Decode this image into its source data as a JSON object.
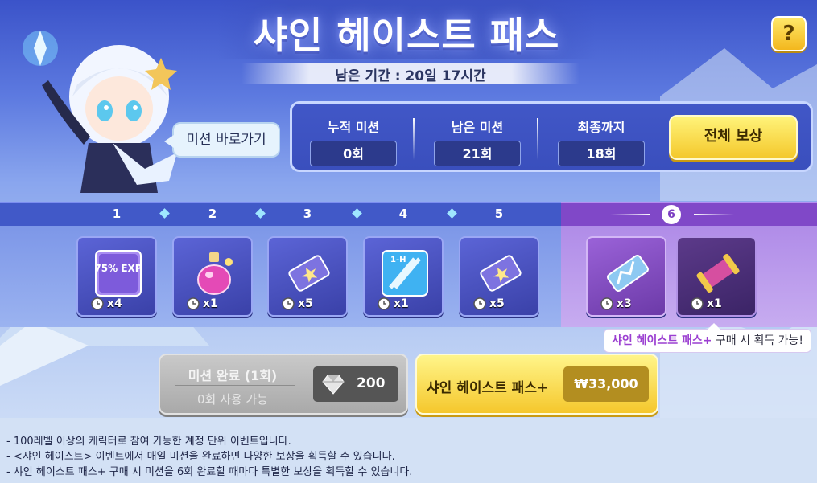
{
  "header": {
    "title": "샤인 헤이스트 패스",
    "period": "남은 기간 : 20일 17시간",
    "help_label": "?"
  },
  "mission_shortcut": "미션 바로가기",
  "stats": [
    {
      "label": "누적 미션",
      "value": "0회"
    },
    {
      "label": "남은 미션",
      "value": "21회"
    },
    {
      "label": "최종까지",
      "value": "18회"
    }
  ],
  "reward_all_label": "전체 보상",
  "steps": [
    "1",
    "2",
    "3",
    "4",
    "5",
    "6"
  ],
  "rewards": [
    {
      "icon": "exp-coupon-icon",
      "qty": "x4",
      "icon_text": "75% EXP"
    },
    {
      "icon": "potion-bottle-icon",
      "qty": "x1"
    },
    {
      "icon": "ticket-icon",
      "qty": "x5"
    },
    {
      "icon": "swords-1h-icon",
      "qty": "x1",
      "icon_text": "1-H"
    },
    {
      "icon": "ticket-icon",
      "qty": "x5"
    },
    {
      "icon": "crystal-ticket-icon",
      "qty": "x3"
    },
    {
      "icon": "scroll-icon",
      "qty": "x1"
    }
  ],
  "plus_tooltip": {
    "accent": "샤인 헤이스트 패스+",
    "rest": " 구매 시 획득 가능!"
  },
  "complete_button": {
    "line1": "미션 완료 (1회)",
    "line2": "0회 사용 가능",
    "price": "200",
    "price_icon": "gem-icon"
  },
  "buy_button": {
    "label": "샤인 헤이스트 패스+",
    "price": "₩33,000"
  },
  "notes": [
    "- 100레벨 이상의 캐릭터로 참여 가능한 계정 단위 이벤트입니다.",
    "- <샤인 헤이스트> 이벤트에서 매일 미션을 완료하면 다양한 보상을 획득할 수 있습니다.",
    "- 샤인 헤이스트 패스+ 구매 시 미션을 6회 완료할 때마다 특별한 보상을 획득할 수 있습니다."
  ],
  "colors": {
    "accent_purple": "#9b3fd1",
    "button_yellow": "#f4c82b",
    "panel_blue": "#4157c7"
  }
}
